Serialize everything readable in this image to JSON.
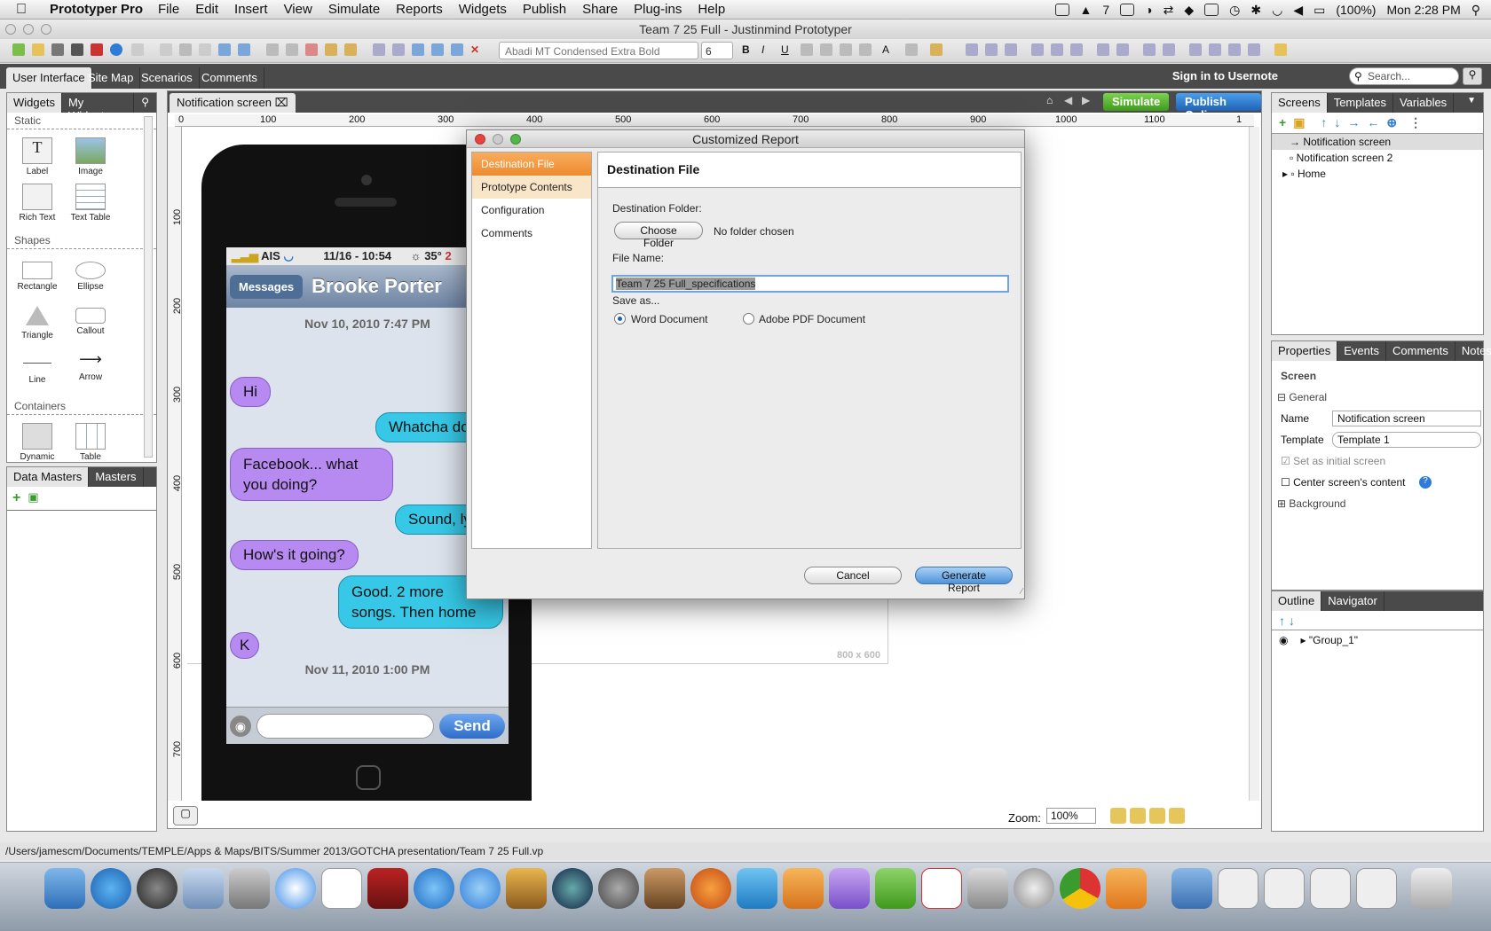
{
  "menubar": {
    "app": "Prototyper Pro",
    "items": [
      "File",
      "Edit",
      "Insert",
      "View",
      "Simulate",
      "Reports",
      "Widgets",
      "Publish",
      "Share",
      "Plug-ins",
      "Help"
    ],
    "status_battery": "(100%)",
    "clock": "Mon 2:28 PM",
    "num_badge": "7"
  },
  "window": {
    "title": "Team 7 25 Full - Justinmind Prototyper"
  },
  "toolbar": {
    "font": "Abadi MT Condensed Extra Bold",
    "size": "6"
  },
  "nav": {
    "tabs": [
      "User Interface",
      "Site Map",
      "Scenarios",
      "Comments"
    ],
    "signin": "Sign in to Usernote",
    "search_placeholder": "Search..."
  },
  "widgets_panel": {
    "tabs": [
      "Widgets",
      "My Widgets"
    ],
    "sections": {
      "static": "Static",
      "shapes": "Shapes",
      "containers": "Containers"
    },
    "static_items": [
      "Label",
      "Image",
      "Rich Text",
      "Text Table"
    ],
    "shape_items": [
      "Rectangle",
      "Ellipse",
      "Triangle",
      "Callout",
      "Line",
      "Arrow"
    ],
    "container_items": [
      "Dynamic",
      "Table"
    ]
  },
  "masters_panel": {
    "tabs": [
      "Data Masters",
      "Masters"
    ]
  },
  "canvas": {
    "tab": "Notification screen",
    "simulate": "Simulate",
    "publish": "Publish Online",
    "ruler_h": [
      "0",
      "100",
      "200",
      "300",
      "400",
      "500",
      "600",
      "700",
      "800",
      "900",
      "1000",
      "1100",
      "1"
    ],
    "ruler_v": [
      "100",
      "200",
      "300",
      "400",
      "500",
      "600",
      "700"
    ],
    "size_label": "800 x 600",
    "zoom_label": "Zoom:",
    "zoom": "100%"
  },
  "phone": {
    "carrier": "AIS",
    "time": "11/16 - 10:54",
    "temp": "35°",
    "temp_suffix": "2",
    "back": "Messages",
    "contact": "Brooke Porter",
    "ts1": "Nov 10, 2010 7:47 PM",
    "ts2": "Nov 11, 2010 1:00 PM",
    "send": "Send",
    "messages": [
      {
        "text": "Hi"
      },
      {
        "text": "Whatcha doi"
      },
      {
        "text": "Facebook... what you doing?"
      },
      {
        "text": "Sound, ly"
      },
      {
        "text": "How's it going?"
      },
      {
        "text": "Good. 2 more songs. Then home"
      },
      {
        "text": "K"
      }
    ]
  },
  "dialog": {
    "title": "Customized Report",
    "nav": [
      "Destination File",
      "Prototype Contents",
      "Configuration",
      "Comments"
    ],
    "header": "Destination File",
    "folder_label": "Destination Folder:",
    "choose": "Choose Folder",
    "no_folder": "No folder chosen",
    "filename_label": "File Name:",
    "filename": "Team 7 25 Full_specifications",
    "saveas_label": "Save as...",
    "opt_word": "Word Document",
    "opt_pdf": "Adobe PDF Document",
    "cancel": "Cancel",
    "generate": "Generate Report"
  },
  "screens_panel": {
    "tabs": [
      "Screens",
      "Templates",
      "Variables"
    ],
    "items": [
      "Notification screen",
      "Notification screen 2",
      "Home"
    ]
  },
  "props_panel": {
    "tabs": [
      "Properties",
      "Events",
      "Comments",
      "Notes"
    ],
    "title": "Screen",
    "general": "General",
    "name_label": "Name",
    "name_value": "Notification screen",
    "template_label": "Template",
    "template_value": "Template 1",
    "initial": "Set as initial screen",
    "center": "Center screen's content",
    "background": "Background"
  },
  "outline_panel": {
    "tabs": [
      "Outline",
      "Navigator"
    ],
    "item": "\"Group_1\""
  },
  "statusbar": {
    "path": "/Users/jamescm/Documents/TEMPLE/Apps & Maps/BITS/Summer 2013/GOTCHA presentation/Team 7 25 Full.vp"
  }
}
